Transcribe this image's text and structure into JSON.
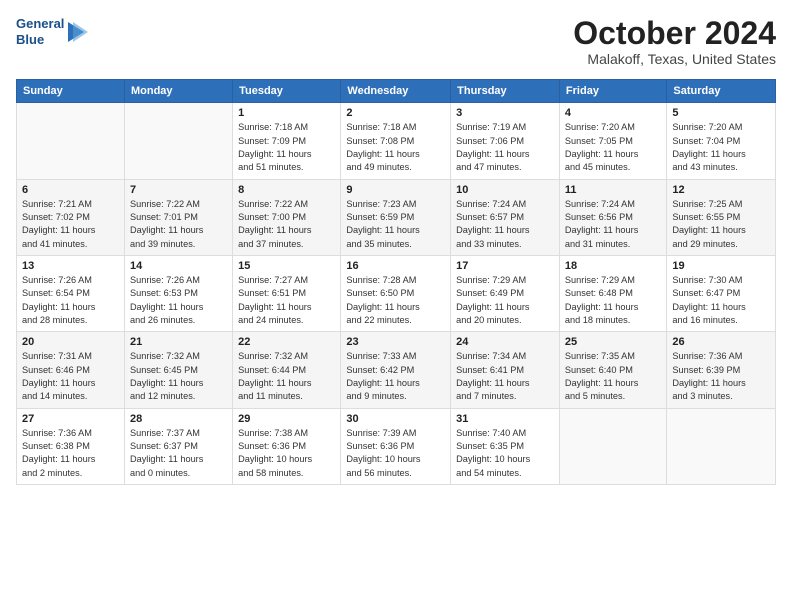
{
  "logo": {
    "line1": "General",
    "line2": "Blue"
  },
  "title": "October 2024",
  "location": "Malakoff, Texas, United States",
  "weekdays": [
    "Sunday",
    "Monday",
    "Tuesday",
    "Wednesday",
    "Thursday",
    "Friday",
    "Saturday"
  ],
  "weeks": [
    [
      {
        "day": "",
        "detail": ""
      },
      {
        "day": "",
        "detail": ""
      },
      {
        "day": "1",
        "detail": "Sunrise: 7:18 AM\nSunset: 7:09 PM\nDaylight: 11 hours\nand 51 minutes."
      },
      {
        "day": "2",
        "detail": "Sunrise: 7:18 AM\nSunset: 7:08 PM\nDaylight: 11 hours\nand 49 minutes."
      },
      {
        "day": "3",
        "detail": "Sunrise: 7:19 AM\nSunset: 7:06 PM\nDaylight: 11 hours\nand 47 minutes."
      },
      {
        "day": "4",
        "detail": "Sunrise: 7:20 AM\nSunset: 7:05 PM\nDaylight: 11 hours\nand 45 minutes."
      },
      {
        "day": "5",
        "detail": "Sunrise: 7:20 AM\nSunset: 7:04 PM\nDaylight: 11 hours\nand 43 minutes."
      }
    ],
    [
      {
        "day": "6",
        "detail": "Sunrise: 7:21 AM\nSunset: 7:02 PM\nDaylight: 11 hours\nand 41 minutes."
      },
      {
        "day": "7",
        "detail": "Sunrise: 7:22 AM\nSunset: 7:01 PM\nDaylight: 11 hours\nand 39 minutes."
      },
      {
        "day": "8",
        "detail": "Sunrise: 7:22 AM\nSunset: 7:00 PM\nDaylight: 11 hours\nand 37 minutes."
      },
      {
        "day": "9",
        "detail": "Sunrise: 7:23 AM\nSunset: 6:59 PM\nDaylight: 11 hours\nand 35 minutes."
      },
      {
        "day": "10",
        "detail": "Sunrise: 7:24 AM\nSunset: 6:57 PM\nDaylight: 11 hours\nand 33 minutes."
      },
      {
        "day": "11",
        "detail": "Sunrise: 7:24 AM\nSunset: 6:56 PM\nDaylight: 11 hours\nand 31 minutes."
      },
      {
        "day": "12",
        "detail": "Sunrise: 7:25 AM\nSunset: 6:55 PM\nDaylight: 11 hours\nand 29 minutes."
      }
    ],
    [
      {
        "day": "13",
        "detail": "Sunrise: 7:26 AM\nSunset: 6:54 PM\nDaylight: 11 hours\nand 28 minutes."
      },
      {
        "day": "14",
        "detail": "Sunrise: 7:26 AM\nSunset: 6:53 PM\nDaylight: 11 hours\nand 26 minutes."
      },
      {
        "day": "15",
        "detail": "Sunrise: 7:27 AM\nSunset: 6:51 PM\nDaylight: 11 hours\nand 24 minutes."
      },
      {
        "day": "16",
        "detail": "Sunrise: 7:28 AM\nSunset: 6:50 PM\nDaylight: 11 hours\nand 22 minutes."
      },
      {
        "day": "17",
        "detail": "Sunrise: 7:29 AM\nSunset: 6:49 PM\nDaylight: 11 hours\nand 20 minutes."
      },
      {
        "day": "18",
        "detail": "Sunrise: 7:29 AM\nSunset: 6:48 PM\nDaylight: 11 hours\nand 18 minutes."
      },
      {
        "day": "19",
        "detail": "Sunrise: 7:30 AM\nSunset: 6:47 PM\nDaylight: 11 hours\nand 16 minutes."
      }
    ],
    [
      {
        "day": "20",
        "detail": "Sunrise: 7:31 AM\nSunset: 6:46 PM\nDaylight: 11 hours\nand 14 minutes."
      },
      {
        "day": "21",
        "detail": "Sunrise: 7:32 AM\nSunset: 6:45 PM\nDaylight: 11 hours\nand 12 minutes."
      },
      {
        "day": "22",
        "detail": "Sunrise: 7:32 AM\nSunset: 6:44 PM\nDaylight: 11 hours\nand 11 minutes."
      },
      {
        "day": "23",
        "detail": "Sunrise: 7:33 AM\nSunset: 6:42 PM\nDaylight: 11 hours\nand 9 minutes."
      },
      {
        "day": "24",
        "detail": "Sunrise: 7:34 AM\nSunset: 6:41 PM\nDaylight: 11 hours\nand 7 minutes."
      },
      {
        "day": "25",
        "detail": "Sunrise: 7:35 AM\nSunset: 6:40 PM\nDaylight: 11 hours\nand 5 minutes."
      },
      {
        "day": "26",
        "detail": "Sunrise: 7:36 AM\nSunset: 6:39 PM\nDaylight: 11 hours\nand 3 minutes."
      }
    ],
    [
      {
        "day": "27",
        "detail": "Sunrise: 7:36 AM\nSunset: 6:38 PM\nDaylight: 11 hours\nand 2 minutes."
      },
      {
        "day": "28",
        "detail": "Sunrise: 7:37 AM\nSunset: 6:37 PM\nDaylight: 11 hours\nand 0 minutes."
      },
      {
        "day": "29",
        "detail": "Sunrise: 7:38 AM\nSunset: 6:36 PM\nDaylight: 10 hours\nand 58 minutes."
      },
      {
        "day": "30",
        "detail": "Sunrise: 7:39 AM\nSunset: 6:36 PM\nDaylight: 10 hours\nand 56 minutes."
      },
      {
        "day": "31",
        "detail": "Sunrise: 7:40 AM\nSunset: 6:35 PM\nDaylight: 10 hours\nand 54 minutes."
      },
      {
        "day": "",
        "detail": ""
      },
      {
        "day": "",
        "detail": ""
      }
    ]
  ]
}
